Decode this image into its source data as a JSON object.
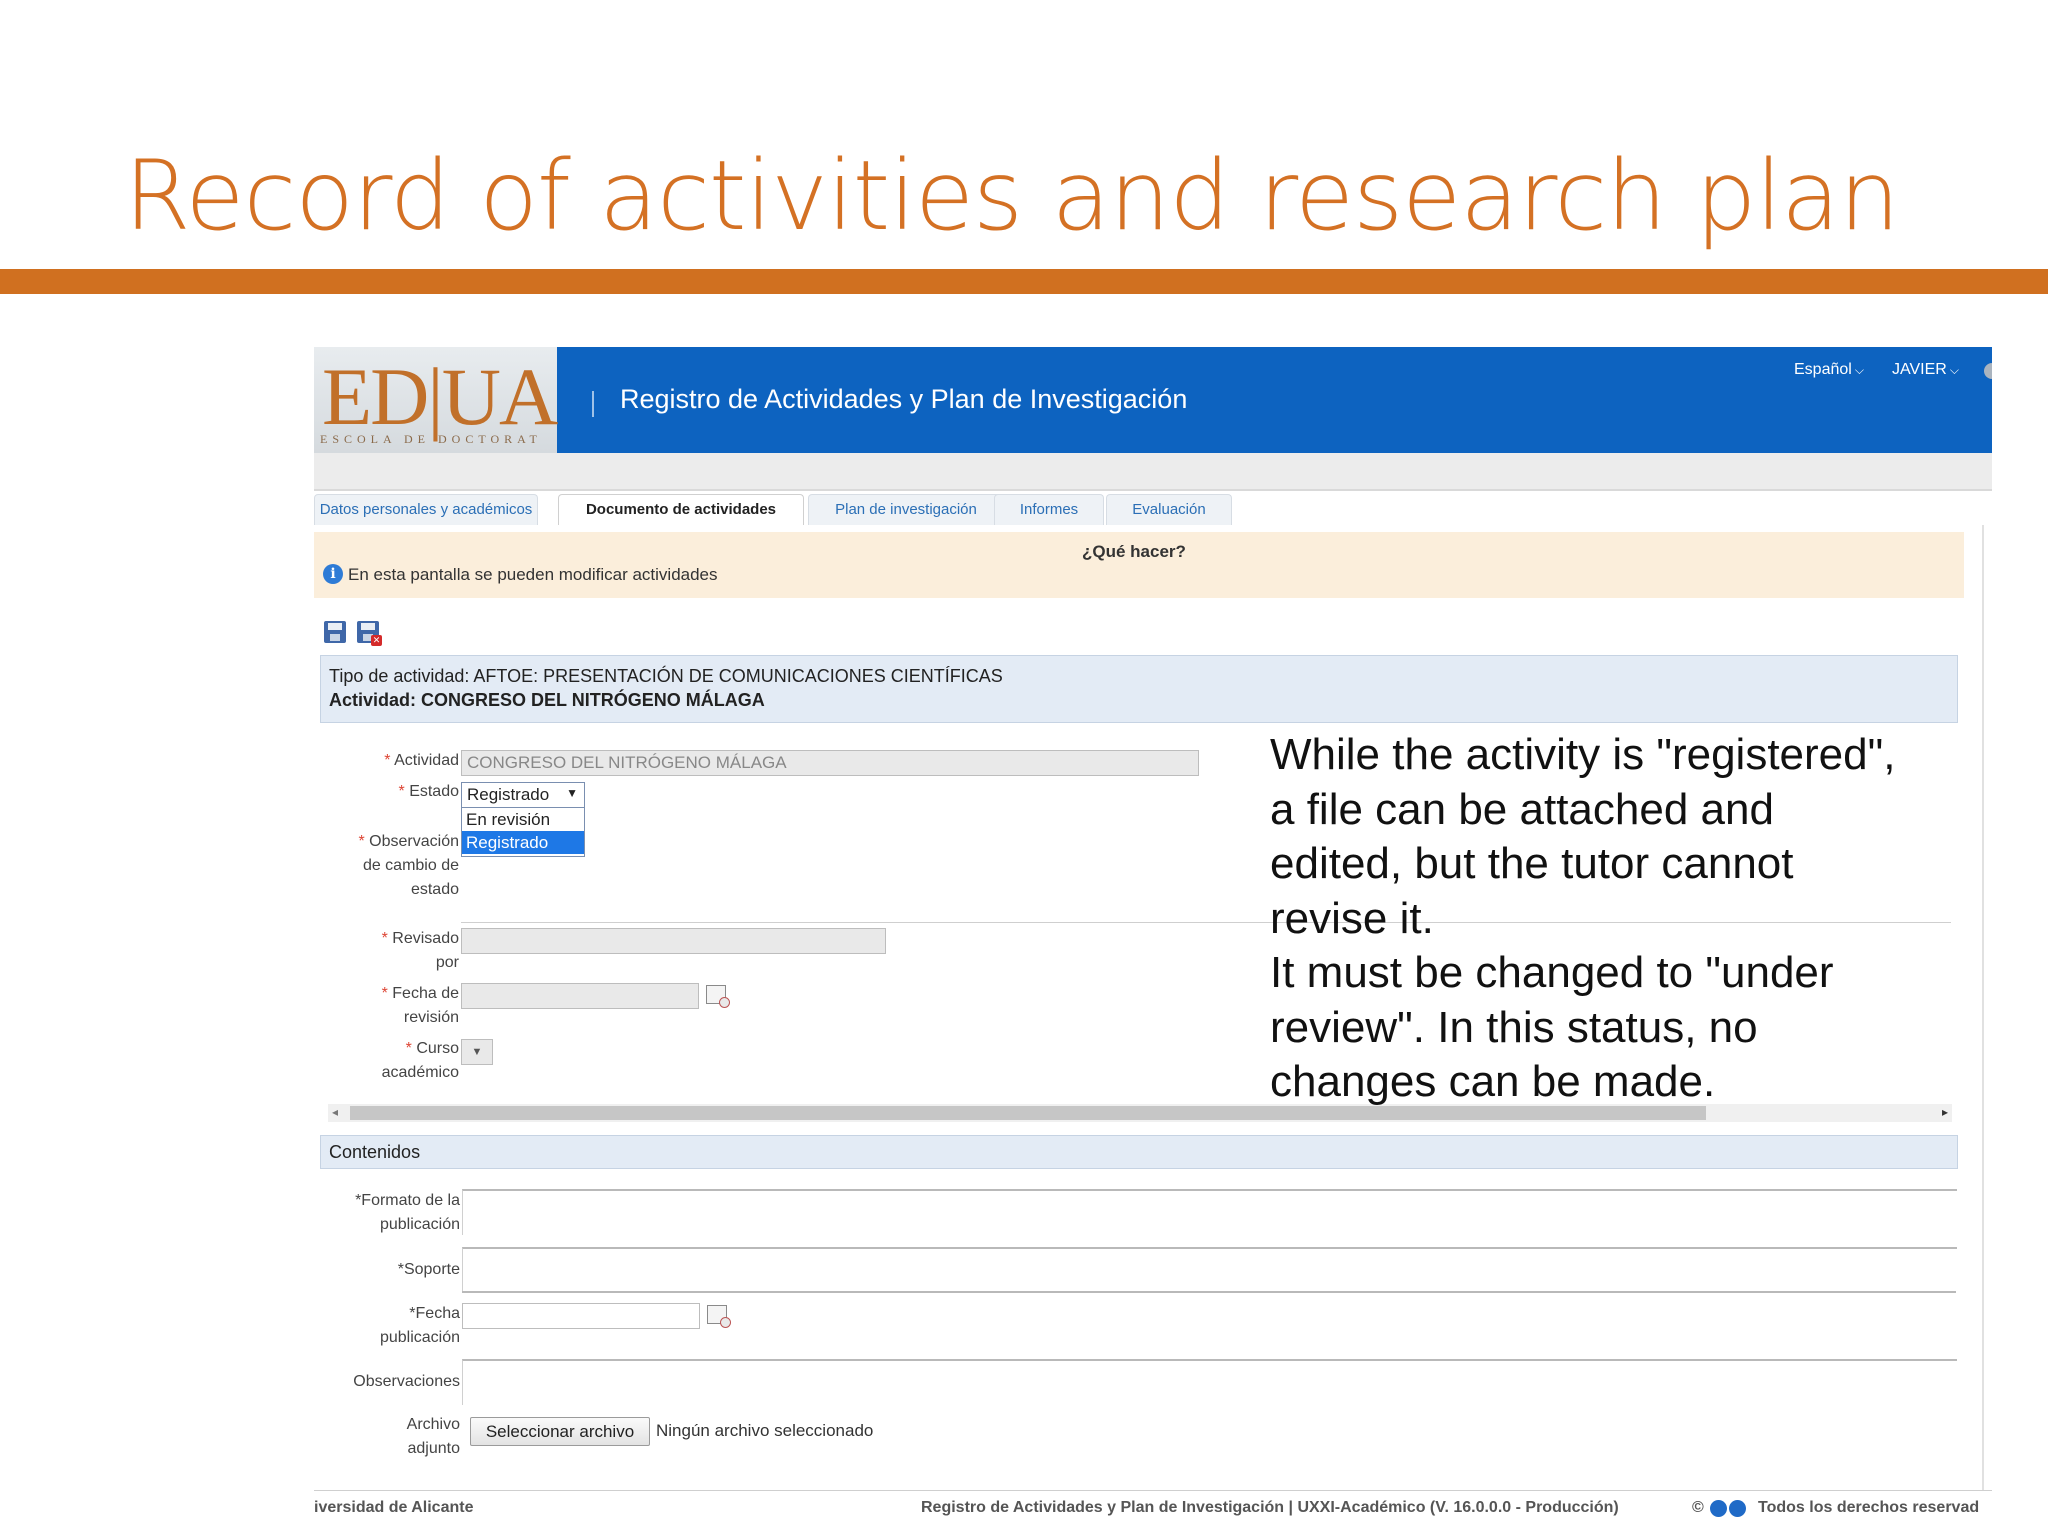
{
  "slide": {
    "title": "Record of activities and research plan"
  },
  "header": {
    "logo_main": "ED|UA",
    "logo_sub": "ESCOLA DE DOCTORAT",
    "app_title": "Registro de Actividades y Plan de Investigación",
    "language": "Español",
    "user": "JAVIER"
  },
  "tabs": [
    {
      "label": "Datos personales y académicos"
    },
    {
      "label": "Documento de actividades"
    },
    {
      "label": "Plan de investigación"
    },
    {
      "label": "Informes"
    },
    {
      "label": "Evaluación"
    }
  ],
  "help": {
    "title": "¿Qué hacer?",
    "text": "En esta pantalla se pueden modificar actividades"
  },
  "activity_header": {
    "type_line": "Tipo de actividad: AFTOE: PRESENTACIÓN DE COMUNICACIONES CIENTÍFICAS",
    "activity_line": "Actividad: CONGRESO DEL NITRÓGENO MÁLAGA"
  },
  "form": {
    "actividad_label": "Actividad",
    "actividad_value": "CONGRESO DEL NITRÓGENO MÁLAGA",
    "estado_label": "Estado",
    "estado_value": "Registrado",
    "estado_options": [
      "En revisión",
      "Registrado"
    ],
    "observacion_label_1": "Observación",
    "observacion_label_2": "de cambio de",
    "observacion_label_3": "estado",
    "revisado_label_1": "Revisado",
    "revisado_label_2": "por",
    "fecha_revision_label_1": "Fecha de",
    "fecha_revision_label_2": "revisión",
    "curso_label_1": "Curso",
    "curso_label_2": "académico"
  },
  "contents": {
    "title": "Contenidos",
    "formato_label_1": "*Formato de la",
    "formato_label_2": "publicación",
    "soporte_label": "*Soporte",
    "fecha_pub_label_1": "*Fecha",
    "fecha_pub_label_2": "publicación",
    "observaciones_label": "Observaciones",
    "archivo_label_1": "Archivo",
    "archivo_label_2": "adjunto",
    "file_button": "Seleccionar archivo",
    "file_status": "Ningún archivo seleccionado"
  },
  "footer": {
    "left": "iversidad de Alicante",
    "center": "Registro de Actividades y Plan de Investigación | UXXI-Académico (V. 16.0.0.0 - Producción)",
    "copyright": "©",
    "right": "Todos los derechos reservad"
  },
  "annotation": {
    "lines": [
      "While the activity is \"registered\",",
      "a file can be attached and",
      "edited, but the tutor cannot",
      "revise it.",
      "It must be changed to \"under",
      "review\". In this status, no",
      "changes can be made."
    ]
  },
  "colors": {
    "accent_orange": "#d47124",
    "header_blue": "#0d63c0",
    "help_bg": "#fbeedb",
    "section_bg": "#e3ebf5"
  }
}
